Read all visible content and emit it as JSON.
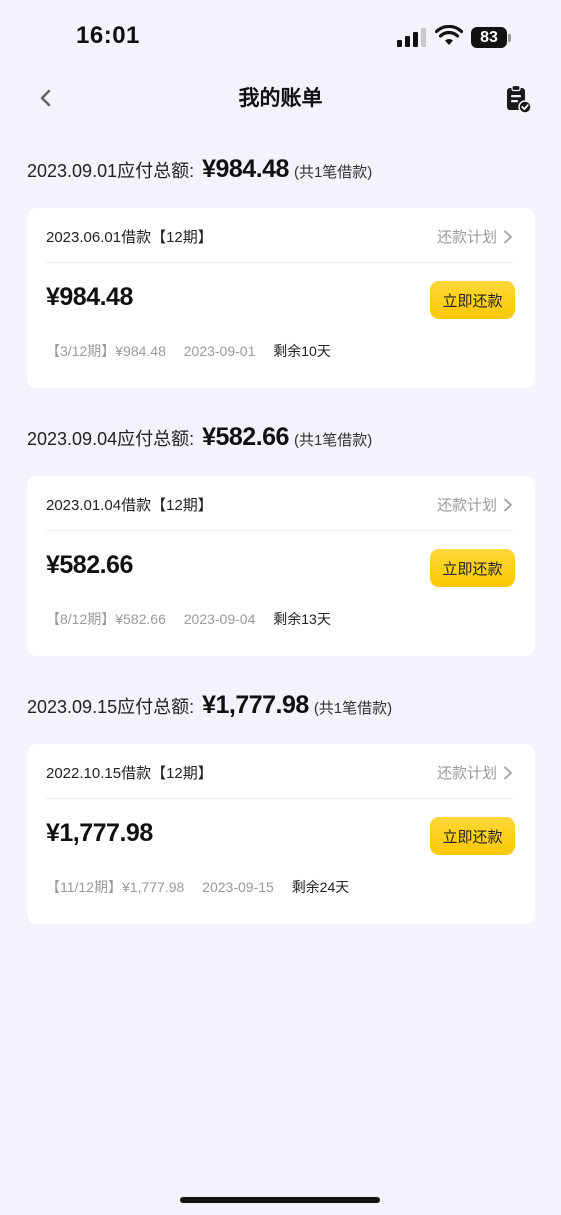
{
  "status_bar": {
    "time": "16:01",
    "battery": "83"
  },
  "nav": {
    "title": "我的账单"
  },
  "labels": {
    "plan_link": "还款计划",
    "pay_button": "立即还款"
  },
  "bills": [
    {
      "header_label": "2023.09.01应付总额:",
      "total": "¥984.48",
      "count": "(共1笔借款)",
      "loan_label": "2023.06.01借款【12期】",
      "amount": "¥984.48",
      "period": "【3/12期】¥984.48",
      "due_date": "2023-09-01",
      "remaining": "剩余10天"
    },
    {
      "header_label": "2023.09.04应付总额:",
      "total": "¥582.66",
      "count": "(共1笔借款)",
      "loan_label": "2023.01.04借款【12期】",
      "amount": "¥582.66",
      "period": "【8/12期】¥582.66",
      "due_date": "2023-09-04",
      "remaining": "剩余13天"
    },
    {
      "header_label": "2023.09.15应付总额:",
      "total": "¥1,777.98",
      "count": "(共1笔借款)",
      "loan_label": "2022.10.15借款【12期】",
      "amount": "¥1,777.98",
      "period": "【11/12期】¥1,777.98",
      "due_date": "2023-09-15",
      "remaining": "剩余24天"
    }
  ],
  "icons": {
    "back": "chevron-left-icon",
    "right_action": "clipboard-check-icon",
    "plan_link": "chevron-right-icon"
  },
  "colors": {
    "background": "#f4f2fb",
    "button": "#fbc800",
    "muted_text": "#9a9a9a"
  }
}
